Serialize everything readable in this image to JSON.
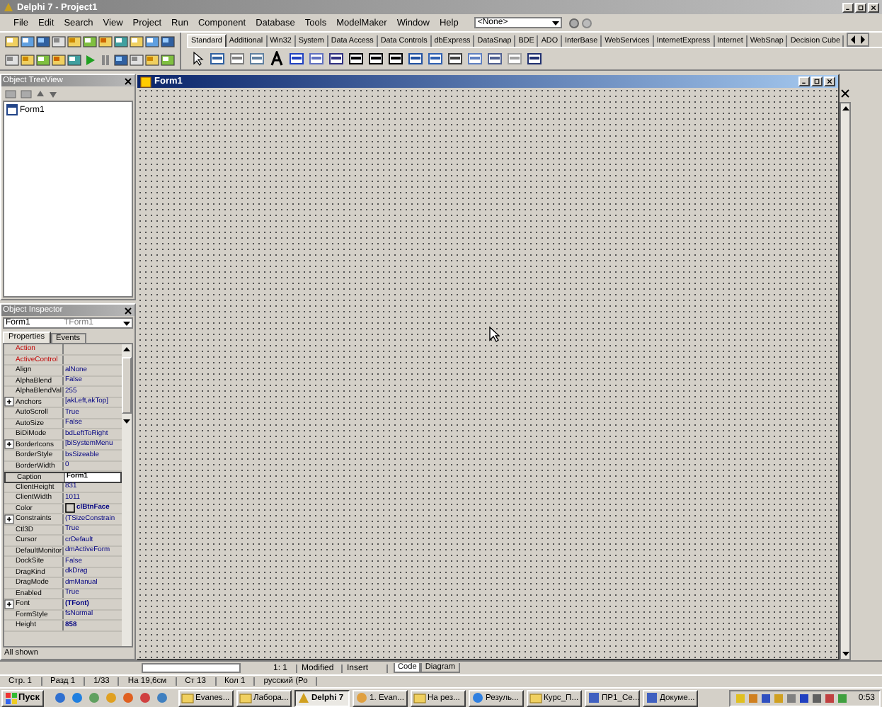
{
  "window": {
    "title": "Delphi 7 - Project1"
  },
  "menu": [
    "File",
    "Edit",
    "Search",
    "View",
    "Project",
    "Run",
    "Component",
    "Database",
    "Tools",
    "ModelMaker",
    "Window",
    "Help"
  ],
  "target_combo": {
    "value": "<None>"
  },
  "palette_tabs": [
    {
      "label": "Standard",
      "selected": true
    },
    {
      "label": "Additional",
      "selected": false
    },
    {
      "label": "Win32",
      "selected": false
    },
    {
      "label": "System",
      "selected": false
    },
    {
      "label": "Data Access",
      "selected": false
    },
    {
      "label": "Data Controls",
      "selected": false
    },
    {
      "label": "dbExpress",
      "selected": false
    },
    {
      "label": "DataSnap",
      "selected": false
    },
    {
      "label": "BDE",
      "selected": false
    },
    {
      "label": "ADO",
      "selected": false
    },
    {
      "label": "InterBase",
      "selected": false
    },
    {
      "label": "WebServices",
      "selected": false
    },
    {
      "label": "InternetExpress",
      "selected": false
    },
    {
      "label": "Internet",
      "selected": false
    },
    {
      "label": "WebSnap",
      "selected": false
    },
    {
      "label": "Decision Cube",
      "selected": false
    }
  ],
  "object_treeview": {
    "title": "Object TreeView",
    "items": [
      {
        "label": "Form1"
      }
    ]
  },
  "object_inspector": {
    "title": "Object Inspector",
    "object": "Form1",
    "class": "TForm1",
    "tabs": [
      {
        "label": "Properties",
        "selected": true
      },
      {
        "label": "Events",
        "selected": false
      }
    ],
    "properties": [
      {
        "name": "Action",
        "kind": "reference",
        "expandable": false,
        "selected": false
      },
      {
        "name": "ActiveControl",
        "kind": "reference",
        "expandable": false,
        "selected": false
      },
      {
        "name": "Align",
        "value": "alNone",
        "kind": "plain",
        "expandable": false,
        "selected": false,
        "modified": false
      },
      {
        "name": "AlphaBlend",
        "value": "False",
        "kind": "plain",
        "expandable": false,
        "selected": false,
        "modified": false
      },
      {
        "name": "AlphaBlendVal",
        "value": "255",
        "kind": "plain",
        "expandable": false,
        "selected": false,
        "modified": false
      },
      {
        "name": "Anchors",
        "value": "[akLeft,akTop]",
        "kind": "plain",
        "expandable": true,
        "selected": false,
        "modified": false
      },
      {
        "name": "AutoScroll",
        "value": "True",
        "kind": "plain",
        "expandable": false,
        "selected": false,
        "modified": false
      },
      {
        "name": "AutoSize",
        "value": "False",
        "kind": "plain",
        "expandable": false,
        "selected": false,
        "modified": false
      },
      {
        "name": "BiDiMode",
        "value": "bdLeftToRight",
        "kind": "plain",
        "expandable": false,
        "selected": false,
        "modified": false
      },
      {
        "name": "BorderIcons",
        "value": "[biSystemMenu",
        "kind": "plain",
        "expandable": true,
        "selected": false,
        "modified": false
      },
      {
        "name": "BorderStyle",
        "value": "bsSizeable",
        "kind": "plain",
        "expandable": false,
        "selected": false,
        "modified": false
      },
      {
        "name": "BorderWidth",
        "value": "0",
        "kind": "plain",
        "expandable": false,
        "selected": false,
        "modified": false
      },
      {
        "name": "Caption",
        "value": "Form1",
        "kind": "plain",
        "expandable": false,
        "selected": true,
        "modified": true
      },
      {
        "name": "ClientHeight",
        "value": "831",
        "kind": "plain",
        "expandable": false,
        "selected": false,
        "modified": false
      },
      {
        "name": "ClientWidth",
        "value": "1011",
        "kind": "plain",
        "expandable": false,
        "selected": false,
        "modified": false
      },
      {
        "name": "Color",
        "value": "clBtnFace",
        "kind": "color",
        "expandable": false,
        "selected": false,
        "modified": true
      },
      {
        "name": "Constraints",
        "value": "(TSizeConstrain",
        "kind": "plain",
        "expandable": true,
        "selected": false,
        "modified": false
      },
      {
        "name": "Ctl3D",
        "value": "True",
        "kind": "plain",
        "expandable": false,
        "selected": false,
        "modified": false
      },
      {
        "name": "Cursor",
        "value": "crDefault",
        "kind": "plain",
        "expandable": false,
        "selected": false,
        "modified": false
      },
      {
        "name": "DefaultMonitor",
        "value": "dmActiveForm",
        "kind": "plain",
        "expandable": false,
        "selected": false,
        "modified": false
      },
      {
        "name": "DockSite",
        "value": "False",
        "kind": "plain",
        "expandable": false,
        "selected": false,
        "modified": false
      },
      {
        "name": "DragKind",
        "value": "dkDrag",
        "kind": "plain",
        "expandable": false,
        "selected": false,
        "modified": false
      },
      {
        "name": "DragMode",
        "value": "dmManual",
        "kind": "plain",
        "expandable": false,
        "selected": false,
        "modified": false
      },
      {
        "name": "Enabled",
        "value": "True",
        "kind": "plain",
        "expandable": false,
        "selected": false,
        "modified": false
      },
      {
        "name": "Font",
        "value": "(TFont)",
        "kind": "plain",
        "expandable": true,
        "selected": false,
        "modified": true
      },
      {
        "name": "FormStyle",
        "value": "fsNormal",
        "kind": "plain",
        "expandable": false,
        "selected": false,
        "modified": false
      },
      {
        "name": "Height",
        "value": "858",
        "kind": "plain",
        "expandable": false,
        "selected": false,
        "modified": true
      }
    ],
    "footer": "All shown"
  },
  "form": {
    "title": "Form1"
  },
  "editor_status": {
    "position": "1: 1",
    "state": "Modified",
    "mode": "Insert",
    "tabs": [
      {
        "label": "Code",
        "selected": true
      },
      {
        "label": "Diagram",
        "selected": false
      }
    ]
  },
  "word_status": [
    "Стр. 1",
    "Разд 1",
    "1/33",
    "На 19,6см",
    "Ст 13",
    "Кол 1",
    "русский (Ро"
  ],
  "taskbar": {
    "start": "Пуск",
    "tasks": [
      {
        "label": "Evanes...",
        "kind": "folder",
        "selected": false
      },
      {
        "label": "Лабора...",
        "kind": "folder",
        "selected": false
      },
      {
        "label": "Delphi 7",
        "kind": "delphi",
        "selected": true
      },
      {
        "label": "1. Evan...",
        "kind": "app",
        "selected": false
      },
      {
        "label": "На рез...",
        "kind": "folder",
        "selected": false
      },
      {
        "label": "Резуль...",
        "kind": "browser",
        "selected": false
      },
      {
        "label": "Курс_П...",
        "kind": "folder",
        "selected": false
      },
      {
        "label": "ПР1_Се...",
        "kind": "document",
        "selected": false
      },
      {
        "label": "Докуме...",
        "kind": "document",
        "selected": false
      }
    ],
    "clock": "0:53"
  }
}
